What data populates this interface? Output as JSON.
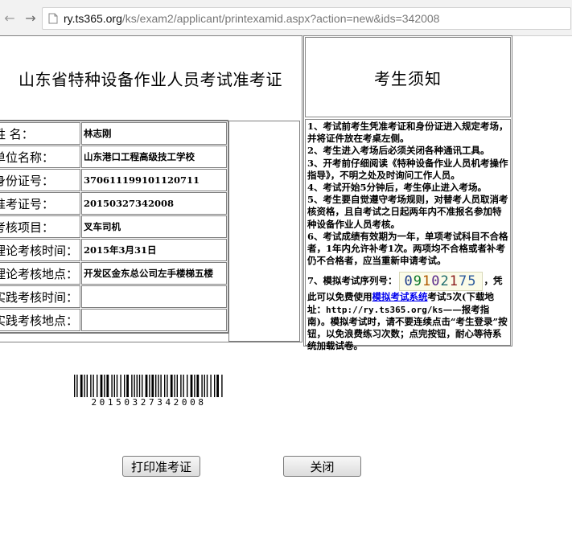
{
  "browser": {
    "url_host": "ry.ts365.org",
    "url_path": "/ks/exam2/applicant/printexamid.aspx?action=new&ids=342008"
  },
  "ticket": {
    "title": "山东省特种设备作业人员考试准考证",
    "rows": [
      {
        "label": "姓      名：",
        "value": "林志刚"
      },
      {
        "label": "单位名称：",
        "value": "山东港口工程高级技工学校"
      },
      {
        "label": "身份证号：",
        "value": "370611199101120711"
      },
      {
        "label": "准考证号：",
        "value": "20150327342008"
      },
      {
        "label": "考核项目：",
        "value": "叉车司机"
      },
      {
        "label": "理论考核时间：",
        "value": "2015年3月31日"
      },
      {
        "label": "理论考核地点：",
        "value": "开发区金东总公司左手楼梯五楼"
      },
      {
        "label": "实践考核时间：",
        "value": ""
      },
      {
        "label": "实践考核地点：",
        "value": ""
      }
    ]
  },
  "notice": {
    "title": "考生须知",
    "items": [
      "1、考试前考生凭准考证和身份证进入规定考场，并将证件放在考桌左侧。",
      "2、考生进入考场后必须关闭各种通讯工具。",
      "3、开考前仔细阅读《特种设备作业人员机考操作指导》，不明之处及时询问工作人员。",
      "4、考试开始5分钟后，考生停止进入考场。",
      "5、考生要自觉遵守考场规则，对替考人员取消考核资格，且自考试之日起两年内不准报名参加特种设备作业人员考核。",
      "6、考试成绩有效期为一年，单项考试科目不合格者，1年内允许补考1次。两项均不合格或者补考仍不合格者，应当重新申请考试。"
    ],
    "item7_prefix": "7、模拟考试序列号：",
    "captcha": [
      "0",
      "9",
      "1",
      "0",
      "2",
      "1",
      "75"
    ],
    "item7_mid": "，凭此可以免费使用",
    "item7_link": "模拟考试系统",
    "item7_after_link": "考试5次(下载地址：",
    "item7_url": "http://ry.ts365.org/ks",
    "item7_after_url": "——报考指南)。模拟考试时，请不要连续点击“考生登录”按钮，以免浪费练习次数；点完按钮，耐心等待系统加载试卷。"
  },
  "barcode": {
    "number": "20150327342008"
  },
  "buttons": {
    "print": "打印准考证",
    "close": "关闭"
  },
  "icons": {
    "back": "back-arrow-icon",
    "forward": "forward-arrow-icon",
    "page": "page-icon"
  }
}
